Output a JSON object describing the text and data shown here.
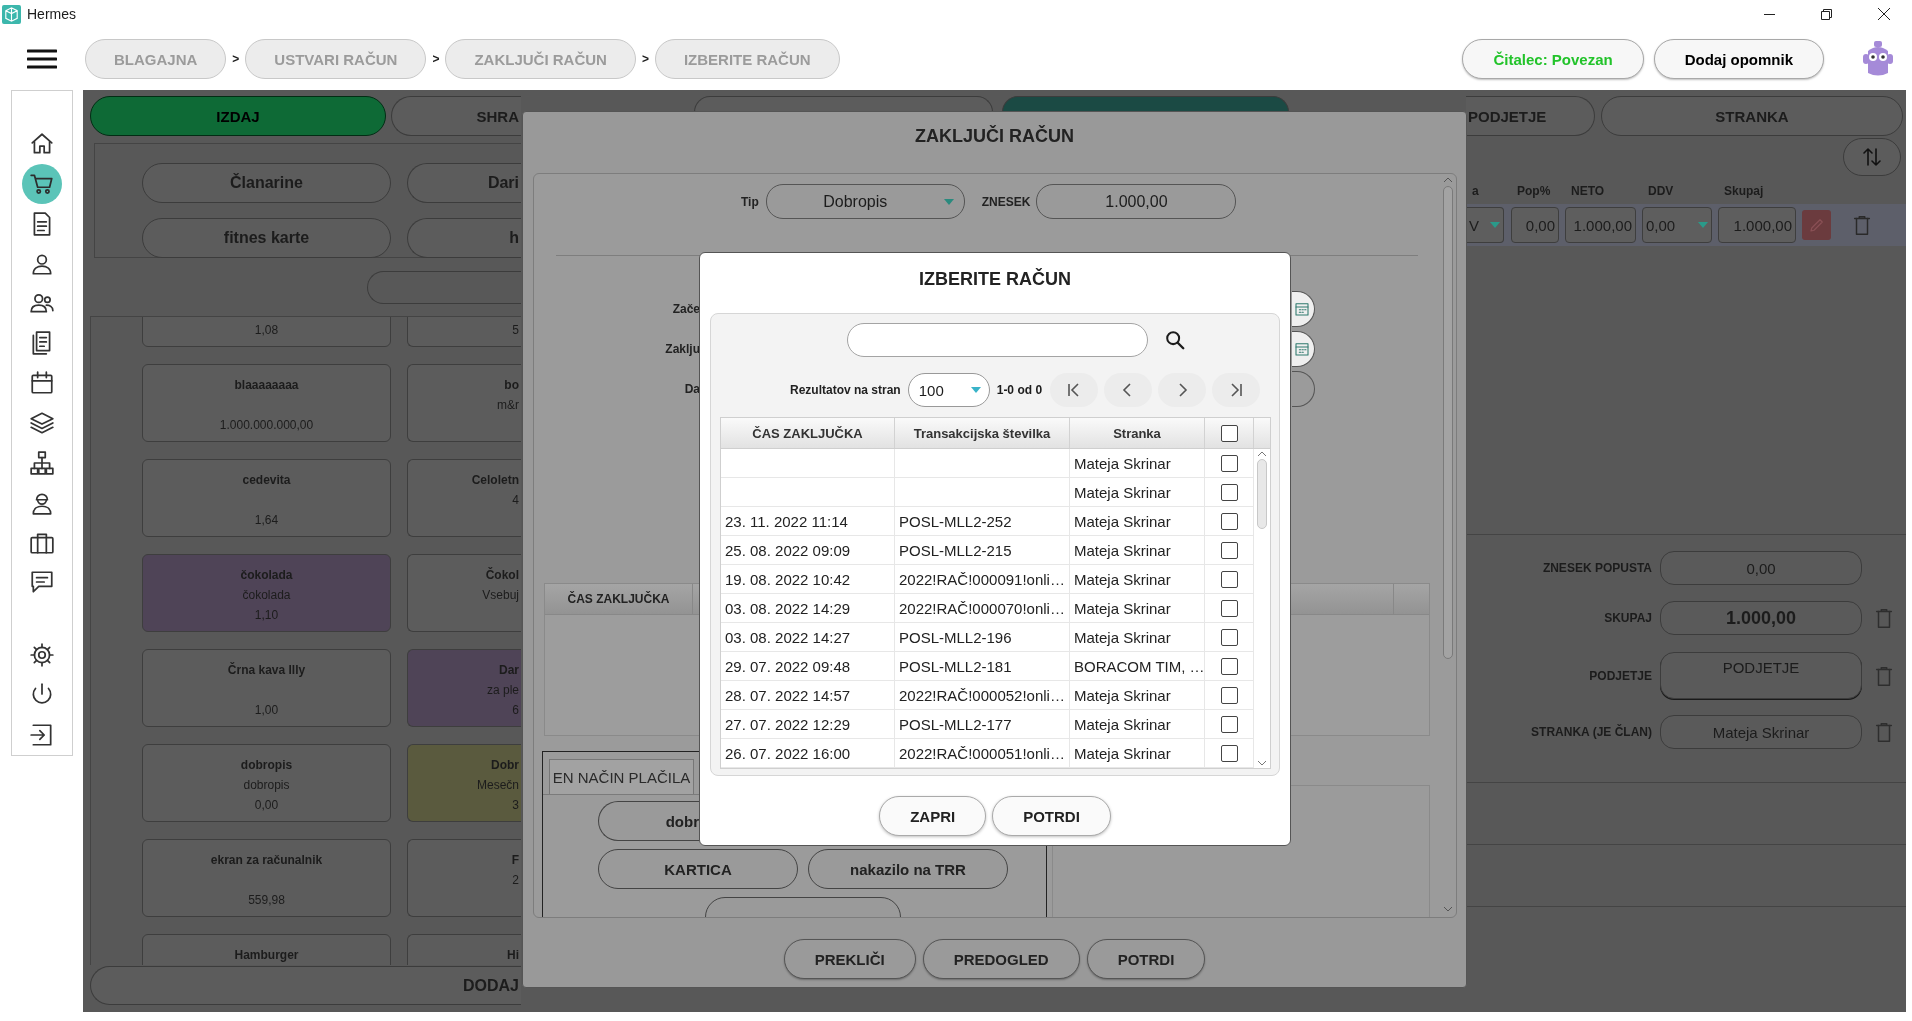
{
  "window": {
    "title": "Hermes"
  },
  "breadcrumbs": [
    {
      "label": "BLAGAJNA",
      "separator": ">"
    },
    {
      "label": "USTVARI RAČUN",
      "separator": ">"
    },
    {
      "label": "ZAKLJUČI RAČUN",
      "separator": ">"
    },
    {
      "label": "IZBERITE RAČUN"
    }
  ],
  "header_buttons": [
    {
      "label": "Čitalec: Povezan",
      "kind": "status"
    },
    {
      "label": "Dodaj opomnik",
      "kind": "action"
    }
  ],
  "sidebar": {
    "items": [
      {
        "kind": "home",
        "selected": false
      },
      {
        "kind": "cart",
        "selected": true
      },
      {
        "kind": "document",
        "selected": false
      },
      {
        "kind": "person",
        "selected": false
      },
      {
        "kind": "people",
        "selected": false
      },
      {
        "kind": "documents",
        "selected": false
      },
      {
        "kind": "calendar",
        "selected": false
      },
      {
        "kind": "layers",
        "selected": false
      },
      {
        "kind": "hierarchy",
        "selected": false
      },
      {
        "kind": "worker",
        "selected": false
      },
      {
        "kind": "briefcase",
        "selected": false
      },
      {
        "kind": "chat",
        "selected": false
      },
      {
        "kind": "settings",
        "selected": false
      },
      {
        "kind": "power",
        "selected": false
      },
      {
        "kind": "logout",
        "selected": false
      }
    ]
  },
  "sale_tabs": [
    {
      "label": "IZDAJ",
      "selected": true
    },
    {
      "label": "SHRA",
      "selected": false
    }
  ],
  "hidden_tabs": [
    {
      "selected": false
    },
    {
      "selected": true
    }
  ],
  "categories": [
    {
      "label": "Članarine"
    },
    {
      "label": "Dari"
    },
    {
      "label": "fitnes karte"
    },
    {
      "label": "h"
    }
  ],
  "products": [
    [
      {
        "price": "1,08"
      },
      {
        "price": "5"
      }
    ],
    [
      {
        "name": "blaaaaaaaa",
        "price": "1.000.000.000,00"
      },
      {
        "name": "bo",
        "description": "m&r"
      }
    ],
    [
      {
        "name": "cedevita",
        "price": "1,64"
      },
      {
        "name": "Celoletn",
        "description": "4"
      }
    ],
    [
      {
        "name": "čokolada",
        "description": "čokolada",
        "price": "1,10",
        "color": "#4f4457"
      },
      {
        "name": "Čokol",
        "description": "Vsebuj"
      }
    ],
    [
      {
        "name": "Črna kava Illy",
        "price": "1,00"
      },
      {
        "name": "Dar",
        "description": "za ple",
        "price": "6",
        "color": "#4f4457"
      }
    ],
    [
      {
        "name": "dobropis",
        "description": "dobropis",
        "price": "0,00"
      },
      {
        "name": "Dobr",
        "description": "Mesečn",
        "price": "3",
        "color": "#5a5a3e"
      }
    ],
    [
      {
        "name": "ekran za računalnik",
        "price": "559,98"
      },
      {
        "name": "F",
        "description": "2"
      }
    ],
    [
      {
        "name": "Hamburger"
      },
      {
        "name": "Hi"
      }
    ]
  ],
  "add_product_button": "DODAJ",
  "invoice_tabs": [
    {
      "label": "PODJETJE",
      "selected": false
    },
    {
      "label": "STRANKA",
      "selected": false
    }
  ],
  "items_table": {
    "columns": [
      "a",
      "Pop%",
      "NETO",
      "DDV",
      "Skupaj"
    ],
    "rows": [
      {
        "unit": "V",
        "discount": "0,00",
        "net": "1.000,00",
        "vat": "0,00",
        "total": "1.000,00"
      }
    ]
  },
  "summary": [
    {
      "label": "ZNESEK POPUSTA",
      "value": "0,00",
      "kind": "amount",
      "removable": false
    },
    {
      "label": "SKUPAJ",
      "value": "1.000,00",
      "kind": "total",
      "removable": true
    },
    {
      "label": "PODJETJE",
      "value": "PODJETJE",
      "kind": "picker",
      "removable": true
    },
    {
      "label": "STRANKA (JE ČLAN)",
      "value": "Mateja Skrinar",
      "kind": "amount",
      "removable": true
    }
  ],
  "close_dialog": {
    "title": "ZAKLJUČI RAČUN",
    "type_label": "Tip",
    "type_value": "Dobropis",
    "amount_label": "ZNESEK",
    "amount_value": "1.000,00",
    "date_labels": [
      "Zače",
      "Zaklju",
      "Da"
    ],
    "table_header": "ČAS ZAKLJUČKA",
    "payment_tab": "EN NAČIN PLAČILA",
    "payment_methods": [
      "dobr",
      "KARTICA",
      "nakazilo na TRR"
    ],
    "buttons": [
      "PREKLIČI",
      "PREDOGLED",
      "POTRDI"
    ]
  },
  "select_dialog": {
    "title": "IZBERITE RAČUN",
    "page_size_label": "Rezultatov na stran",
    "page_size": "100",
    "range": "1-0 od 0",
    "columns": [
      "ČAS ZAKLJUČKA",
      "Transakcijska številka",
      "Stranka"
    ],
    "select_all": {
      "checked": false
    },
    "rows": [
      {
        "customer": "Mateja Skrinar",
        "checked": false
      },
      {
        "customer": "Mateja Skrinar",
        "checked": false
      },
      {
        "time": "23. 11. 2022 11:14",
        "transaction": "POSL-MLL2-252",
        "customer": "Mateja Skrinar",
        "checked": false
      },
      {
        "time": "25. 08. 2022 09:09",
        "transaction": "POSL-MLL2-215",
        "customer": "Mateja Skrinar",
        "checked": false
      },
      {
        "time": "19. 08. 2022 10:42",
        "transaction": "2022!RAČ!000091!onli…",
        "customer": "Mateja Skrinar",
        "checked": false
      },
      {
        "time": "03. 08. 2022 14:29",
        "transaction": "2022!RAČ!000070!onli…",
        "customer": "Mateja Skrinar",
        "checked": false
      },
      {
        "time": "03. 08. 2022 14:27",
        "transaction": "POSL-MLL2-196",
        "customer": "Mateja Skrinar",
        "checked": false
      },
      {
        "time": "29. 07. 2022 09:48",
        "transaction": "POSL-MLL2-181",
        "customer": "BORACOM TIM, …",
        "checked": false
      },
      {
        "time": "28. 07. 2022 14:57",
        "transaction": "2022!RAČ!000052!onli…",
        "customer": "Mateja Skrinar",
        "checked": false
      },
      {
        "time": "27. 07. 2022 12:29",
        "transaction": "POSL-MLL2-177",
        "customer": "Mateja Skrinar",
        "checked": false
      },
      {
        "time": "26. 07. 2022 16:00",
        "transaction": "2022!RAČ!000051!onli…",
        "customer": "Mateja Skrinar",
        "checked": false
      }
    ],
    "buttons": [
      "ZAPRI",
      "POTRDI"
    ]
  }
}
